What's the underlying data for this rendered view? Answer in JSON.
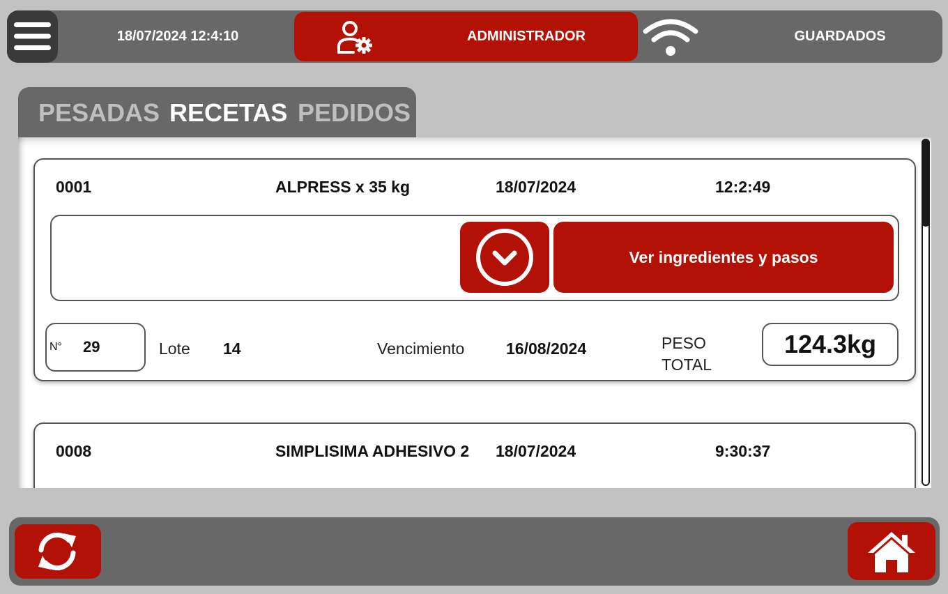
{
  "header": {
    "datetime": "18/07/2024 12:4:10",
    "user_role": "ADMINISTRADOR",
    "saved_label": "GUARDADOS",
    "menu_icon": "hamburger-menu-icon",
    "user_icon": "user-settings-icon",
    "wifi_icon": "wifi-icon"
  },
  "tabs": [
    {
      "label": "PESADAS",
      "active": false
    },
    {
      "label": "RECETAS",
      "active": true
    },
    {
      "label": "PEDIDOS",
      "active": false
    }
  ],
  "records": [
    {
      "code": "0001",
      "name": "ALPRESS x 35 kg",
      "date": "18/07/2024",
      "time": "12:2:49",
      "expand_icon": "chevron-down-circle-icon",
      "action_label": "Ver ingredientes y pasos",
      "number_prefix": "N°",
      "number": "29",
      "lot_label": "Lote",
      "lot_value": "14",
      "expiry_label": "Vencimiento",
      "expiry_value": "16/08/2024",
      "weight_label": "PESO TOTAL",
      "weight_value": "124.3kg"
    },
    {
      "code": "0008",
      "name": "SIMPLISIMA ADHESIVO 2",
      "date": "18/07/2024",
      "time": "9:30:37"
    }
  ],
  "footer": {
    "refresh_icon": "refresh-icon",
    "home_icon": "home-icon"
  },
  "colors": {
    "accent": "#b31106",
    "bar": "#686868",
    "background": "#c2c2c2",
    "panel": "#ffffff"
  }
}
